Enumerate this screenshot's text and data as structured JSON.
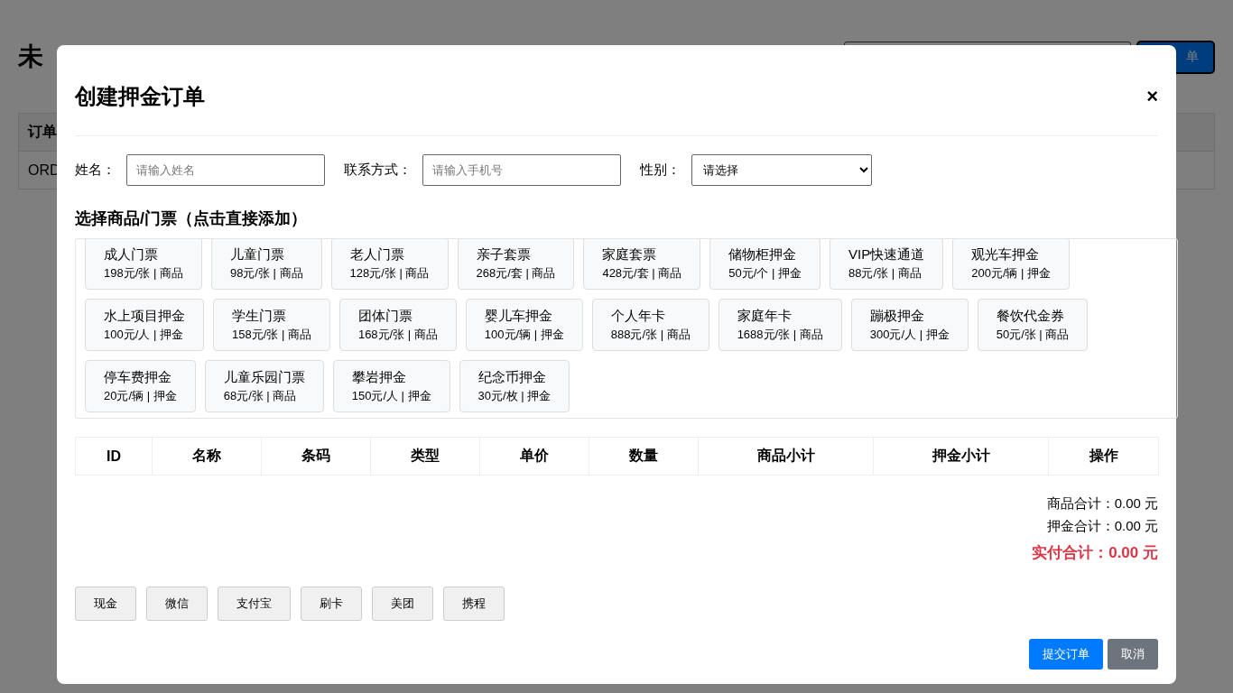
{
  "background_page": {
    "title": "未",
    "button": "单",
    "table": {
      "columns": [
        "订单"
      ],
      "rows": [
        [
          "ORD"
        ]
      ]
    }
  },
  "modal": {
    "title": "创建押金订单",
    "close": "×",
    "fields": [
      {
        "kind": "input",
        "label": "姓名：",
        "placeholder": "请输入姓名"
      },
      {
        "kind": "input",
        "label": "联系方式：",
        "placeholder": "请输入手机号"
      },
      {
        "kind": "select",
        "label": "性别：",
        "value": "请选择"
      }
    ],
    "products_heading": "选择商品/门票（点击直接添加）",
    "products": [
      {
        "name": "成人门票",
        "detail": "198元/张 | 商品"
      },
      {
        "name": "儿童门票",
        "detail": "98元/张 | 商品"
      },
      {
        "name": "老人门票",
        "detail": "128元/张 | 商品"
      },
      {
        "name": "亲子套票",
        "detail": "268元/套 | 商品"
      },
      {
        "name": "家庭套票",
        "detail": "428元/套 | 商品"
      },
      {
        "name": "储物柜押金",
        "detail": "50元/个 | 押金"
      },
      {
        "name": "VIP快速通道",
        "detail": "88元/张 | 商品"
      },
      {
        "name": "观光车押金",
        "detail": "200元/辆 | 押金"
      },
      {
        "name": "水上项目押金",
        "detail": "100元/人 | 押金"
      },
      {
        "name": "学生门票",
        "detail": "158元/张 | 商品"
      },
      {
        "name": "团体门票",
        "detail": "168元/张 | 商品"
      },
      {
        "name": "婴儿车押金",
        "detail": "100元/辆 | 押金"
      },
      {
        "name": "个人年卡",
        "detail": "888元/张 | 商品"
      },
      {
        "name": "家庭年卡",
        "detail": "1688元/张 | 商品"
      },
      {
        "name": "蹦极押金",
        "detail": "300元/人 | 押金"
      },
      {
        "name": "餐饮代金券",
        "detail": "50元/张 | 商品"
      },
      {
        "name": "停车费押金",
        "detail": "20元/辆 | 押金"
      },
      {
        "name": "儿童乐园门票",
        "detail": "68元/张 | 商品"
      },
      {
        "name": "攀岩押金",
        "detail": "150元/人 | 押金"
      },
      {
        "name": "纪念币押金",
        "detail": "30元/枚 | 押金"
      }
    ],
    "cart_table": {
      "columns": [
        "ID",
        "名称",
        "条码",
        "类型",
        "单价",
        "数量",
        "商品小计",
        "押金小计",
        "操作"
      ]
    },
    "totals": [
      {
        "kind": "normal",
        "text": "商品合计：0.00 元"
      },
      {
        "kind": "normal",
        "text": "押金合计：0.00 元"
      },
      {
        "kind": "grand",
        "text": "实付合计：0.00 元"
      }
    ],
    "payment_methods": [
      "现金",
      "微信",
      "支付宝",
      "刷卡",
      "美团",
      "携程"
    ],
    "actions": [
      {
        "kind": "primary",
        "label": "提交订单"
      },
      {
        "kind": "secondary",
        "label": "取消"
      }
    ]
  }
}
